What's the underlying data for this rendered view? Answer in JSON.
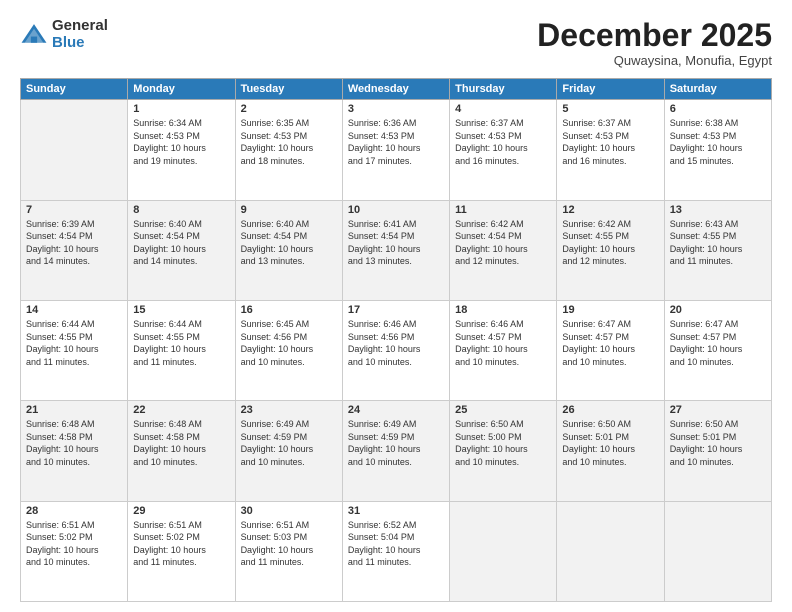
{
  "header": {
    "logo_general": "General",
    "logo_blue": "Blue",
    "month": "December 2025",
    "location": "Quwaysina, Monufia, Egypt"
  },
  "days_of_week": [
    "Sunday",
    "Monday",
    "Tuesday",
    "Wednesday",
    "Thursday",
    "Friday",
    "Saturday"
  ],
  "weeks": [
    [
      {
        "day": "",
        "info": ""
      },
      {
        "day": "1",
        "info": "Sunrise: 6:34 AM\nSunset: 4:53 PM\nDaylight: 10 hours\nand 19 minutes."
      },
      {
        "day": "2",
        "info": "Sunrise: 6:35 AM\nSunset: 4:53 PM\nDaylight: 10 hours\nand 18 minutes."
      },
      {
        "day": "3",
        "info": "Sunrise: 6:36 AM\nSunset: 4:53 PM\nDaylight: 10 hours\nand 17 minutes."
      },
      {
        "day": "4",
        "info": "Sunrise: 6:37 AM\nSunset: 4:53 PM\nDaylight: 10 hours\nand 16 minutes."
      },
      {
        "day": "5",
        "info": "Sunrise: 6:37 AM\nSunset: 4:53 PM\nDaylight: 10 hours\nand 16 minutes."
      },
      {
        "day": "6",
        "info": "Sunrise: 6:38 AM\nSunset: 4:53 PM\nDaylight: 10 hours\nand 15 minutes."
      }
    ],
    [
      {
        "day": "7",
        "info": "Sunrise: 6:39 AM\nSunset: 4:54 PM\nDaylight: 10 hours\nand 14 minutes."
      },
      {
        "day": "8",
        "info": "Sunrise: 6:40 AM\nSunset: 4:54 PM\nDaylight: 10 hours\nand 14 minutes."
      },
      {
        "day": "9",
        "info": "Sunrise: 6:40 AM\nSunset: 4:54 PM\nDaylight: 10 hours\nand 13 minutes."
      },
      {
        "day": "10",
        "info": "Sunrise: 6:41 AM\nSunset: 4:54 PM\nDaylight: 10 hours\nand 13 minutes."
      },
      {
        "day": "11",
        "info": "Sunrise: 6:42 AM\nSunset: 4:54 PM\nDaylight: 10 hours\nand 12 minutes."
      },
      {
        "day": "12",
        "info": "Sunrise: 6:42 AM\nSunset: 4:55 PM\nDaylight: 10 hours\nand 12 minutes."
      },
      {
        "day": "13",
        "info": "Sunrise: 6:43 AM\nSunset: 4:55 PM\nDaylight: 10 hours\nand 11 minutes."
      }
    ],
    [
      {
        "day": "14",
        "info": "Sunrise: 6:44 AM\nSunset: 4:55 PM\nDaylight: 10 hours\nand 11 minutes."
      },
      {
        "day": "15",
        "info": "Sunrise: 6:44 AM\nSunset: 4:55 PM\nDaylight: 10 hours\nand 11 minutes."
      },
      {
        "day": "16",
        "info": "Sunrise: 6:45 AM\nSunset: 4:56 PM\nDaylight: 10 hours\nand 10 minutes."
      },
      {
        "day": "17",
        "info": "Sunrise: 6:46 AM\nSunset: 4:56 PM\nDaylight: 10 hours\nand 10 minutes."
      },
      {
        "day": "18",
        "info": "Sunrise: 6:46 AM\nSunset: 4:57 PM\nDaylight: 10 hours\nand 10 minutes."
      },
      {
        "day": "19",
        "info": "Sunrise: 6:47 AM\nSunset: 4:57 PM\nDaylight: 10 hours\nand 10 minutes."
      },
      {
        "day": "20",
        "info": "Sunrise: 6:47 AM\nSunset: 4:57 PM\nDaylight: 10 hours\nand 10 minutes."
      }
    ],
    [
      {
        "day": "21",
        "info": "Sunrise: 6:48 AM\nSunset: 4:58 PM\nDaylight: 10 hours\nand 10 minutes."
      },
      {
        "day": "22",
        "info": "Sunrise: 6:48 AM\nSunset: 4:58 PM\nDaylight: 10 hours\nand 10 minutes."
      },
      {
        "day": "23",
        "info": "Sunrise: 6:49 AM\nSunset: 4:59 PM\nDaylight: 10 hours\nand 10 minutes."
      },
      {
        "day": "24",
        "info": "Sunrise: 6:49 AM\nSunset: 4:59 PM\nDaylight: 10 hours\nand 10 minutes."
      },
      {
        "day": "25",
        "info": "Sunrise: 6:50 AM\nSunset: 5:00 PM\nDaylight: 10 hours\nand 10 minutes."
      },
      {
        "day": "26",
        "info": "Sunrise: 6:50 AM\nSunset: 5:01 PM\nDaylight: 10 hours\nand 10 minutes."
      },
      {
        "day": "27",
        "info": "Sunrise: 6:50 AM\nSunset: 5:01 PM\nDaylight: 10 hours\nand 10 minutes."
      }
    ],
    [
      {
        "day": "28",
        "info": "Sunrise: 6:51 AM\nSunset: 5:02 PM\nDaylight: 10 hours\nand 10 minutes."
      },
      {
        "day": "29",
        "info": "Sunrise: 6:51 AM\nSunset: 5:02 PM\nDaylight: 10 hours\nand 11 minutes."
      },
      {
        "day": "30",
        "info": "Sunrise: 6:51 AM\nSunset: 5:03 PM\nDaylight: 10 hours\nand 11 minutes."
      },
      {
        "day": "31",
        "info": "Sunrise: 6:52 AM\nSunset: 5:04 PM\nDaylight: 10 hours\nand 11 minutes."
      },
      {
        "day": "",
        "info": ""
      },
      {
        "day": "",
        "info": ""
      },
      {
        "day": "",
        "info": ""
      }
    ]
  ]
}
